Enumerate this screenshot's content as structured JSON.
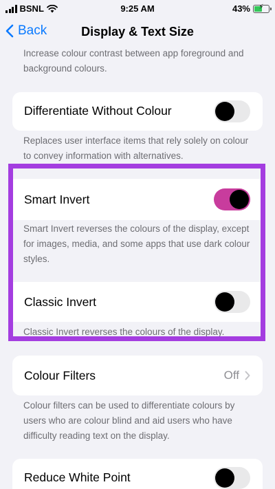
{
  "status_bar": {
    "carrier": "BSNL",
    "time": "9:25 AM",
    "battery": "43%"
  },
  "nav": {
    "back_label": "Back",
    "title": "Display & Text Size"
  },
  "sections": {
    "contrast_note": "Increase colour contrast between app foreground and background colours.",
    "differentiate": {
      "label": "Differentiate Without Colour",
      "enabled": false,
      "note": "Replaces user interface items that rely solely on colour to convey information with alternatives."
    },
    "smart_invert": {
      "label": "Smart Invert",
      "enabled": true,
      "note": "Smart Invert reverses the colours of the display, except for images, media, and some apps that use dark colour styles."
    },
    "classic_invert": {
      "label": "Classic Invert",
      "enabled": false,
      "note": "Classic Invert reverses the colours of the display."
    },
    "colour_filters": {
      "label": "Colour Filters",
      "value": "Off",
      "note": "Colour filters can be used to differentiate colours by users who are colour blind and aid users who have difficulty reading text on the display."
    },
    "reduce_white_point": {
      "label": "Reduce White Point",
      "enabled": false
    }
  },
  "colors": {
    "accent_blue": "#0a7aff",
    "toggle_on": "#c83c9d",
    "highlight_border": "#a43de0",
    "background": "#f2f2f7"
  }
}
